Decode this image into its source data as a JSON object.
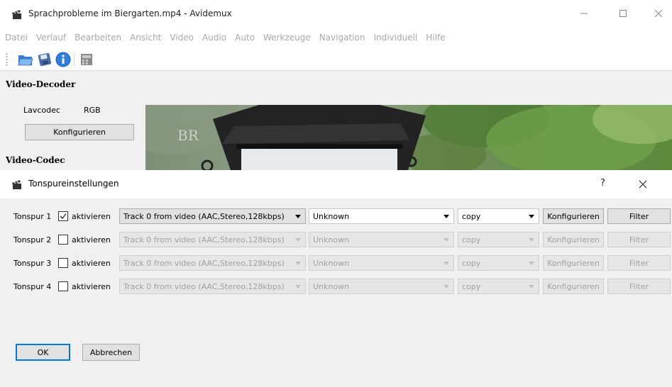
{
  "main_window": {
    "title": "Sprachprobleme im Biergarten.mp4 - Avidemux",
    "menu": [
      "Datei",
      "Verlauf",
      "Bearbeiten",
      "Ansicht",
      "Video",
      "Audio",
      "Auto",
      "Werkzeuge",
      "Navigation",
      "Individuell",
      "Hilfe"
    ],
    "toolbar_icons": [
      "open-folder-icon",
      "save-disk-icon",
      "info-icon",
      "film-calculator-icon"
    ],
    "video_decoder": {
      "section_title": "Video-Decoder",
      "decoder": "Lavcodec",
      "format": "RGB",
      "configure_label": "Konfigurieren"
    },
    "video_codec_title": "Video-Codec",
    "preview_logo": "BR"
  },
  "dialog": {
    "title": "Tonspureinstellungen",
    "help": "?",
    "enable_label": "aktivieren",
    "tracks": [
      {
        "label": "Tonspur 1",
        "checked": true,
        "source": "Track 0 from video (AAC,Stereo,128kbps)",
        "language": "Unknown",
        "codec": "copy",
        "configure": "Konfigurieren",
        "filter": "Filter",
        "enabled": true
      },
      {
        "label": "Tonspur 2",
        "checked": false,
        "source": "Track 0 from video (AAC,Stereo,128kbps)",
        "language": "Unknown",
        "codec": "copy",
        "configure": "Konfigurieren",
        "filter": "Filter",
        "enabled": false
      },
      {
        "label": "Tonspur 3",
        "checked": false,
        "source": "Track 0 from video (AAC,Stereo,128kbps)",
        "language": "Unknown",
        "codec": "copy",
        "configure": "Konfigurieren",
        "filter": "Filter",
        "enabled": false
      },
      {
        "label": "Tonspur 4",
        "checked": false,
        "source": "Track 0 from video (AAC,Stereo,128kbps)",
        "language": "Unknown",
        "codec": "copy",
        "configure": "Konfigurieren",
        "filter": "Filter",
        "enabled": false
      }
    ],
    "ok_label": "OK",
    "cancel_label": "Abbrechen"
  },
  "colors": {
    "accent": "#0078d7",
    "menu_text_disabled": "#a8a8a8"
  }
}
